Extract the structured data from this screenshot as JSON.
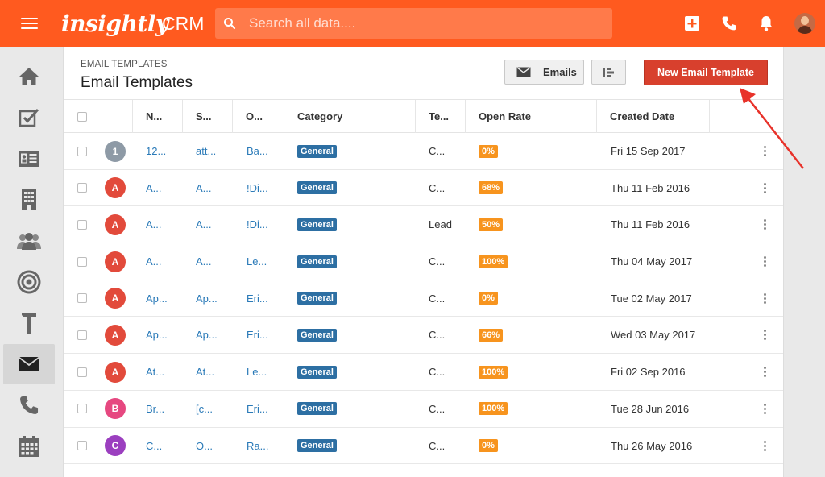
{
  "topbar": {
    "menu_icon": "hamburger-icon",
    "logo": "insightly",
    "app": "CRM",
    "search_placeholder": "Search all data....",
    "icons": [
      "add-icon",
      "phone-icon",
      "bell-icon",
      "user-avatar"
    ]
  },
  "sidebar": {
    "items": [
      {
        "icon": "home-icon"
      },
      {
        "icon": "tasks-icon"
      },
      {
        "icon": "contacts-icon"
      },
      {
        "icon": "organizations-icon"
      },
      {
        "icon": "leads-icon"
      },
      {
        "icon": "opportunities-icon"
      },
      {
        "icon": "projects-icon"
      },
      {
        "icon": "email-icon",
        "active": true
      },
      {
        "icon": "calls-icon"
      },
      {
        "icon": "calendar-icon"
      }
    ]
  },
  "header": {
    "breadcrumb": "EMAIL TEMPLATES",
    "title": "Email Templates",
    "emails_button": "Emails",
    "new_button": "New Email Template"
  },
  "table": {
    "columns": [
      "N...",
      "S...",
      "O...",
      "Category",
      "Te...",
      "Open Rate",
      "Created Date"
    ],
    "rows": [
      {
        "badge": "1",
        "color": "#8e9aa6",
        "name": "12...",
        "subject": "att...",
        "owner": "Ba...",
        "category": "General",
        "type": "C...",
        "rate": "0%",
        "date": "Fri 15 Sep 2017"
      },
      {
        "badge": "A",
        "color": "#e24a3b",
        "name": "A...",
        "subject": "A...",
        "owner": "!Di...",
        "category": "General",
        "type": "C...",
        "rate": "68%",
        "date": "Thu 11 Feb 2016"
      },
      {
        "badge": "A",
        "color": "#e24a3b",
        "name": "A...",
        "subject": "A...",
        "owner": "!Di...",
        "category": "General",
        "type": "Lead",
        "rate": "50%",
        "date": "Thu 11 Feb 2016"
      },
      {
        "badge": "A",
        "color": "#e24a3b",
        "name": "A...",
        "subject": "A...",
        "owner": "Le...",
        "category": "General",
        "type": "C...",
        "rate": "100%",
        "date": "Thu 04 May 2017"
      },
      {
        "badge": "A",
        "color": "#e24a3b",
        "name": "Ap...",
        "subject": "Ap...",
        "owner": "Eri...",
        "category": "General",
        "type": "C...",
        "rate": "0%",
        "date": "Tue 02 May 2017"
      },
      {
        "badge": "A",
        "color": "#e24a3b",
        "name": "Ap...",
        "subject": "Ap...",
        "owner": "Eri...",
        "category": "General",
        "type": "C...",
        "rate": "66%",
        "date": "Wed 03 May 2017"
      },
      {
        "badge": "A",
        "color": "#e24a3b",
        "name": "At...",
        "subject": "At...",
        "owner": "Le...",
        "category": "General",
        "type": "C...",
        "rate": "100%",
        "date": "Fri 02 Sep 2016"
      },
      {
        "badge": "B",
        "color": "#e64880",
        "name": "Br...",
        "subject": "[c...",
        "owner": "Eri...",
        "category": "General",
        "type": "C...",
        "rate": "100%",
        "date": "Tue 28 Jun 2016"
      },
      {
        "badge": "C",
        "color": "#9b3fbf",
        "name": "C...",
        "subject": "O...",
        "owner": "Ra...",
        "category": "General",
        "type": "C...",
        "rate": "0%",
        "date": "Thu 26 May 2016"
      }
    ]
  },
  "colors": {
    "brand": "#ff5a1f",
    "primary_button": "#d8402d",
    "link": "#2a7ab8",
    "category_tag": "#2d6fa3",
    "rate_tag": "#f7941e",
    "annotation_arrow": "#e8322a"
  }
}
